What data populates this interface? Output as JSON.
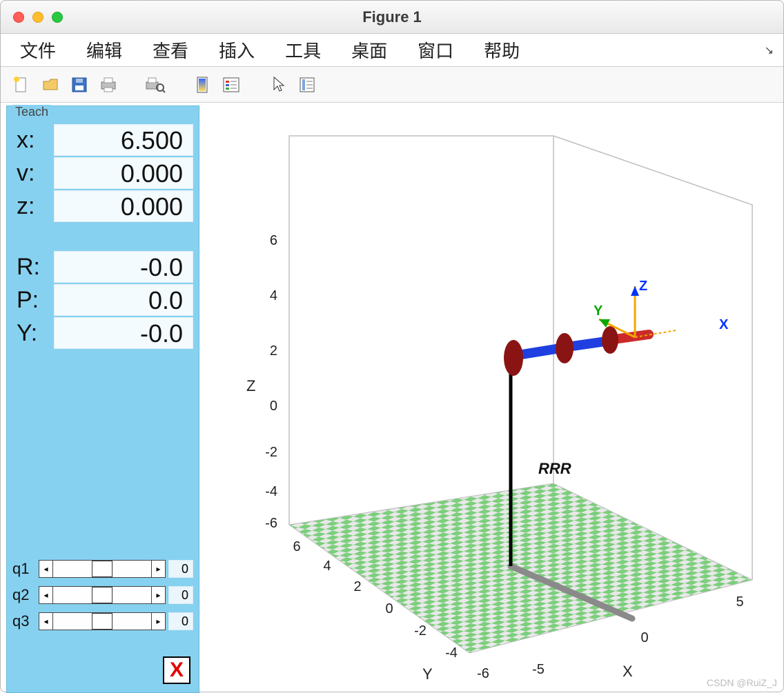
{
  "window": {
    "title": "Figure 1"
  },
  "menu": [
    "文件",
    "编辑",
    "查看",
    "插入",
    "工具",
    "桌面",
    "窗口",
    "帮助"
  ],
  "toolbar_icons": [
    "new-file",
    "open-file",
    "save-file",
    "print",
    "print-preview",
    "divider",
    "rectangle",
    "color-grid",
    "divider",
    "pointer",
    "data-cursor"
  ],
  "teach": {
    "title": "Teach",
    "pose": {
      "x_label": "x:",
      "x": "6.500",
      "y_label": "v:",
      "y": "0.000",
      "z_label": "z:",
      "z": "0.000",
      "R_label": "R:",
      "R": "-0.0",
      "P_label": "P:",
      "P": "0.0",
      "Y_label": "Y:",
      "Y": "-0.0"
    },
    "joints": [
      {
        "label": "q1",
        "value": "0"
      },
      {
        "label": "q2",
        "value": "0"
      },
      {
        "label": "q3",
        "value": "0"
      }
    ],
    "exit_label": "X"
  },
  "chart_data": {
    "type": "3d-robot-plot",
    "robot_name": "RRR",
    "axes": {
      "x": {
        "label": "X",
        "ticks": [
          -5,
          0,
          5
        ]
      },
      "y": {
        "label": "Y",
        "ticks": [
          -6,
          -4,
          -2,
          0,
          2,
          4,
          6
        ]
      },
      "z": {
        "label": "Z",
        "ticks": [
          -6,
          -4,
          -2,
          0,
          2,
          4,
          6
        ]
      }
    },
    "floor_z": -6.5,
    "floor_extent": 6.5,
    "base_position": {
      "x": 0,
      "y": 0,
      "z": 0
    },
    "links": [
      {
        "from": [
          0,
          0,
          0
        ],
        "to": [
          2,
          0,
          0
        ],
        "type": "revolute"
      },
      {
        "from": [
          2,
          0,
          0
        ],
        "to": [
          4,
          0,
          0
        ],
        "type": "revolute"
      },
      {
        "from": [
          4,
          0,
          0
        ],
        "to": [
          6.5,
          0,
          0
        ],
        "type": "revolute-end"
      }
    ],
    "end_effector": {
      "x": 6.5,
      "y": 0,
      "z": 0
    },
    "frame_axes": {
      "X": "blue",
      "Y": "green",
      "Z": "blue"
    },
    "shadow": true
  },
  "watermark": "CSDN @RuiZ_J"
}
